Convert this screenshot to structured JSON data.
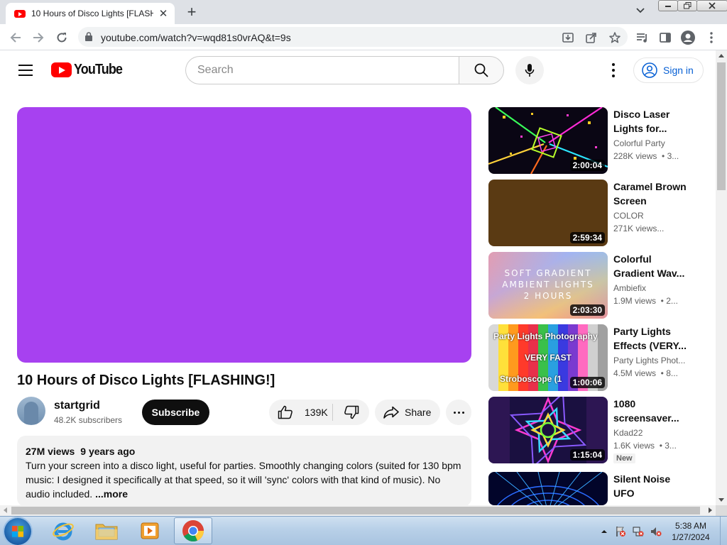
{
  "browser": {
    "tab_title": "10 Hours of Disco Lights [FLASHING!] - YouTube",
    "url": "youtube.com/watch?v=wqd81s0vrAQ&t=9s",
    "new_tab_glyph": "+",
    "tab_close_glyph": "✕"
  },
  "youtube": {
    "logo_text": "YouTube",
    "search_placeholder": "Search",
    "signin_label": "Sign in"
  },
  "video": {
    "title": "10 Hours of Disco Lights [FLASHING!]",
    "player_color": "#a741f0",
    "channel": "startgrid",
    "subscribers": "48.2K subscribers",
    "subscribe_label": "Subscribe",
    "likes": "139K",
    "share_label": "Share",
    "views": "27M views",
    "age": "9 years ago",
    "description": "Turn your screen into a disco light, useful for parties. Smoothly changing colors (suited for 130 bpm music: I designed it specifically at that speed, so it will 'sync' colors with that kind of music). No audio included.",
    "more_label": "...more"
  },
  "recommendations": [
    {
      "title1": "Disco Laser",
      "title2": "Lights for...",
      "channel": "Colorful Party",
      "stats": "228K views  • 3...",
      "duration": "2:00:04",
      "thumb": "laser"
    },
    {
      "title1": "Caramel Brown",
      "title2": "Screen",
      "channel": "COLOR",
      "stats": "271K views...",
      "duration": "2:59:34",
      "thumb": "brown"
    },
    {
      "title1": "Colorful",
      "title2": "Gradient Wav...",
      "channel": "Ambiefix",
      "stats": "1.9M views  • 2...",
      "duration": "2:03:30",
      "thumb": "gradient",
      "thumb_text": [
        "SOFT GRADIENT",
        "AMBIENT LIGHTS",
        "2 HOURS"
      ]
    },
    {
      "title1": "Party Lights",
      "title2": "Effects (VERY...",
      "channel": "Party Lights Phot...",
      "stats": "4.5M views  • 8...",
      "duration": "1:00:06",
      "thumb": "stripes",
      "thumb_text": [
        "Party Lights Photography",
        "VERY FAST",
        "Stroboscope (1"
      ]
    },
    {
      "title1": "1080",
      "title2": "screensaver...",
      "channel": "Kdad22",
      "stats": "1.6K views  • 3...",
      "duration": "1:15:04",
      "thumb": "kaleido",
      "badge": "New"
    },
    {
      "title1": "Silent Noise",
      "title2": "UFO",
      "channel": "",
      "stats": "",
      "duration": "",
      "thumb": "tunnel"
    }
  ],
  "taskbar": {
    "time": "5:38 AM",
    "date": "1/27/2024"
  },
  "colors": {
    "youtube_red": "#ff0000",
    "link_blue": "#065fd4",
    "brown_thumb": "#5a3a13"
  }
}
